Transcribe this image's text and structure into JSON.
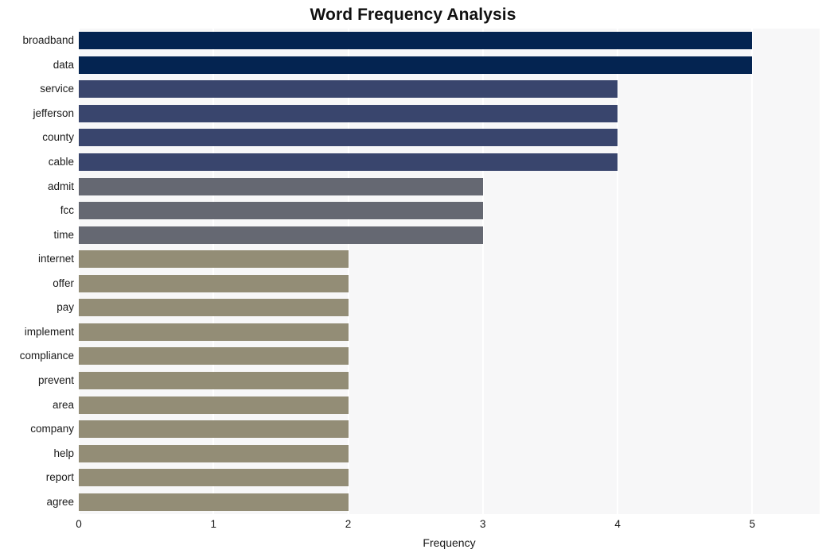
{
  "chart_data": {
    "type": "bar",
    "orientation": "horizontal",
    "title": "Word Frequency Analysis",
    "xlabel": "Frequency",
    "ylabel": "",
    "categories": [
      "broadband",
      "data",
      "service",
      "jefferson",
      "county",
      "cable",
      "admit",
      "fcc",
      "time",
      "internet",
      "offer",
      "pay",
      "implement",
      "compliance",
      "prevent",
      "area",
      "company",
      "help",
      "report",
      "agree"
    ],
    "values": [
      5,
      5,
      4,
      4,
      4,
      4,
      3,
      3,
      3,
      2,
      2,
      2,
      2,
      2,
      2,
      2,
      2,
      2,
      2,
      2
    ],
    "bar_colors": [
      "#042451",
      "#042451",
      "#39456d",
      "#39456d",
      "#39456d",
      "#39456d",
      "#656872",
      "#656872",
      "#656872",
      "#938d76",
      "#938d76",
      "#938d76",
      "#938d76",
      "#938d76",
      "#938d76",
      "#938d76",
      "#938d76",
      "#938d76",
      "#938d76",
      "#938d76"
    ],
    "xlim": [
      0,
      5.5
    ],
    "xticks": [
      0,
      1,
      2,
      3,
      4,
      5
    ],
    "xticklabels": [
      "0",
      "1",
      "2",
      "3",
      "4",
      "5"
    ],
    "grid": true,
    "grid_axis": "x",
    "grid_color": "#ffffff",
    "plot_background": "#f7f7f8",
    "figure_background": "#ffffff",
    "legend": null,
    "annotations": []
  }
}
